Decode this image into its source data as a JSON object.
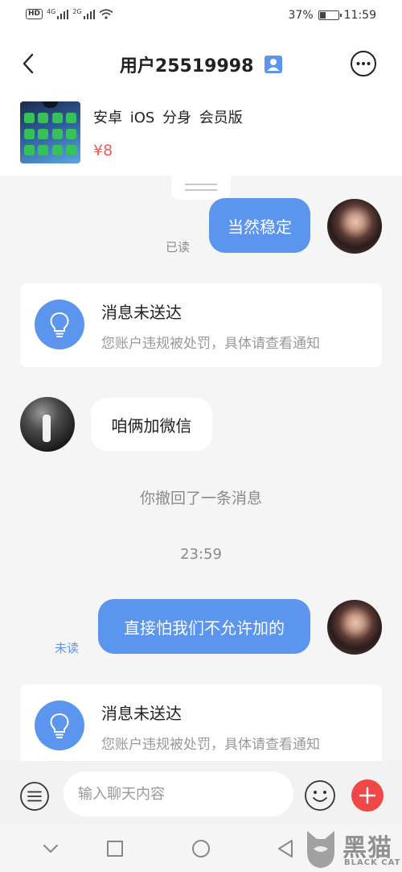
{
  "status_bar": {
    "hd": "HD",
    "net1": "4G",
    "net2": "2G",
    "battery_text": "37%",
    "battery_level": 0.37,
    "time": "11:59"
  },
  "header": {
    "title": "用户25519998"
  },
  "product": {
    "name": "安卓 iOS 分身 会员版",
    "price": "¥8"
  },
  "messages": {
    "m1": {
      "text": "当然稳定",
      "status": "已读"
    },
    "notice1": {
      "title": "消息未送达",
      "desc": "您账户违规被处罚，具体请查看通知"
    },
    "m2": {
      "text": "咱俩加微信"
    },
    "recall": "你撤回了一条消息",
    "timestamp": "23:59",
    "m3": {
      "text": "直接怕我们不允许加的",
      "status": "未读"
    },
    "notice2": {
      "title": "消息未送达",
      "desc": "您账户违规被处罚，具体请查看通知"
    }
  },
  "input": {
    "placeholder": "输入聊天内容"
  },
  "watermark": {
    "cn": "黑猫",
    "en": "BLACK CAT"
  },
  "colors": {
    "accent_blue": "#5b95ee",
    "price_red": "#f05a5a",
    "plus_red": "#f04848",
    "read_gray": "#8a8a8a",
    "unread_blue": "#5b95ee",
    "background": "#f5f5f5"
  },
  "icons": {
    "back": "back-arrow-icon",
    "badge": "user-badge-icon",
    "more": "more-icon",
    "notice": "lightbulb-icon",
    "menu": "menu-icon",
    "emoji": "emoji-icon",
    "plus": "plus-icon"
  }
}
